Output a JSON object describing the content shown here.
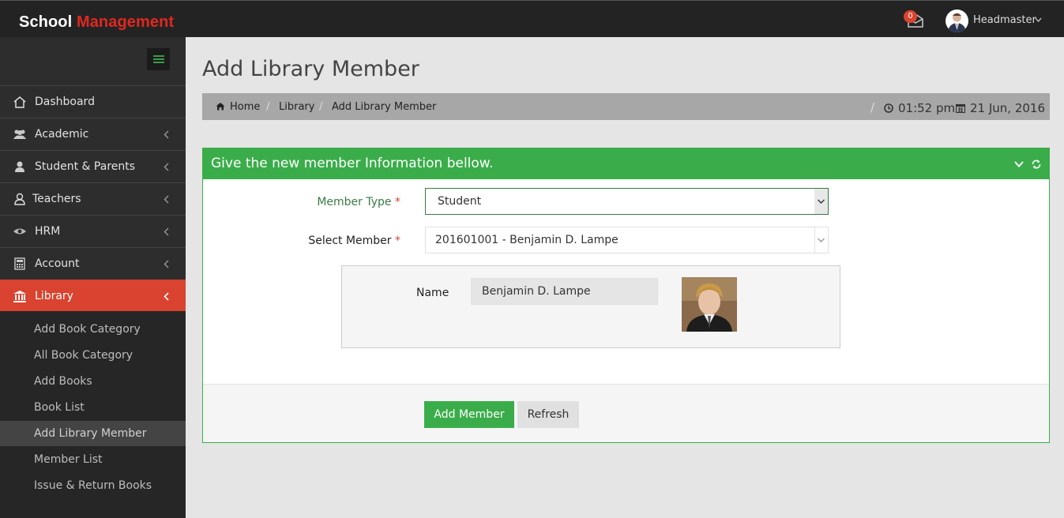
{
  "brand": {
    "part1": "School",
    "part2": "Management"
  },
  "header": {
    "mail_count": "0",
    "user_name": "Headmaster"
  },
  "colors": {
    "accent_red": "#d9432f",
    "green": "#3aad4a",
    "topbar": "#232323",
    "sidebar": "#2d2d2d"
  },
  "sidebar": {
    "items": [
      {
        "label": "Dashboard",
        "icon": "home-icon"
      },
      {
        "label": "Academic",
        "icon": "users-icon"
      },
      {
        "label": "Student & Parents",
        "icon": "user-icon"
      },
      {
        "label": "Teachers",
        "icon": "teacher-icon"
      },
      {
        "label": "HRM",
        "icon": "eye-icon"
      },
      {
        "label": "Account",
        "icon": "calculator-icon"
      },
      {
        "label": "Library",
        "icon": "bank-icon"
      }
    ],
    "submenu": [
      "Add Book Category",
      "All Book Category",
      "Add Books",
      "Book List",
      "Add Library Member",
      "Member List",
      "Issue & Return Books"
    ]
  },
  "page": {
    "title": "Add Library Member",
    "breadcrumb": [
      "Home",
      "Library",
      "Add Library Member"
    ],
    "time": "01:52 pm",
    "date": "21 Jun, 2016"
  },
  "panel": {
    "title": "Give the new member Information bellow.",
    "member_type_label": "Member Type",
    "member_type_value": "Student",
    "select_member_label": "Select Member",
    "select_member_value": "201601001 - Benjamin D. Lampe",
    "name_label": "Name",
    "name_value": "Benjamin D. Lampe",
    "required_mark": "*",
    "add_button": "Add Member",
    "refresh_button": "Refresh"
  }
}
